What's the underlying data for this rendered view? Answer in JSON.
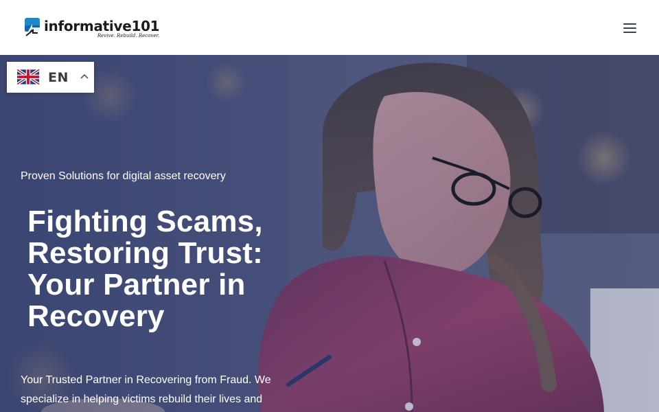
{
  "header": {
    "logo_name": "informative101",
    "logo_tagline": "Revive. Rebuild. Recover.",
    "menu_icon": "hamburger-menu-icon"
  },
  "language_switcher": {
    "code": "EN",
    "flag_icon": "uk-flag-icon",
    "caret_icon": "chevron-up-icon"
  },
  "hero": {
    "kicker": "Proven Solutions for digital asset recovery",
    "title": "Fighting Scams, Restoring Trust: Your Partner in Recovery",
    "description": "Your Trusted Partner in Recovering from Fraud. We specialize in helping victims rebuild their lives and"
  },
  "colors": {
    "logo_blue": "#1e88c8",
    "logo_dark": "#1b1b1b",
    "hero_text": "#ffffff",
    "shirt": "#8a3d66"
  }
}
